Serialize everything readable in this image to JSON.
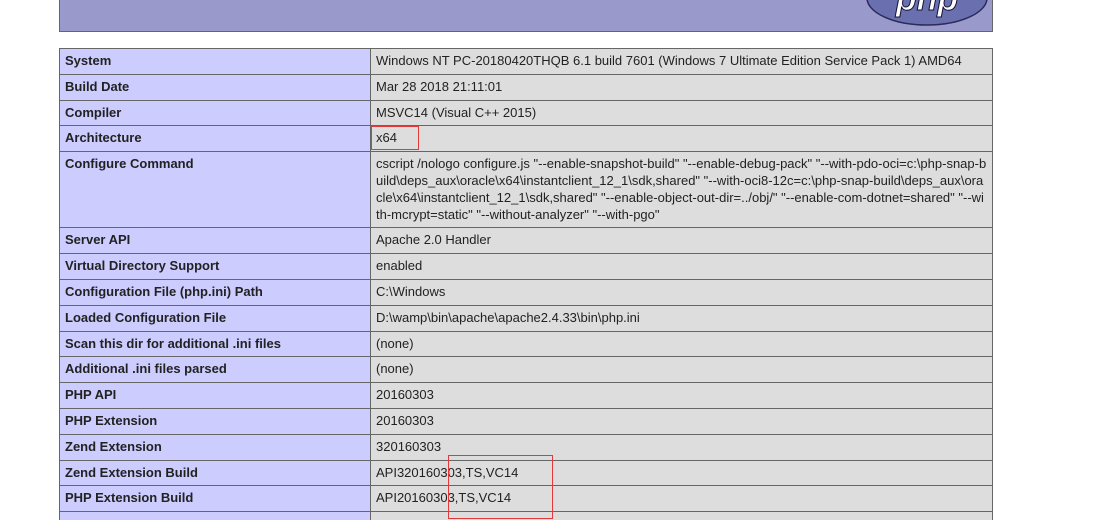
{
  "header": {
    "logo_text": "php"
  },
  "rows": [
    {
      "key": "System",
      "value": "Windows NT PC-20180420THQB 6.1 build 7601 (Windows 7 Ultimate Edition Service Pack 1) AMD64"
    },
    {
      "key": "Build Date",
      "value": "Mar 28 2018 21:11:01"
    },
    {
      "key": "Compiler",
      "value": "MSVC14 (Visual C++ 2015)"
    },
    {
      "key": "Architecture",
      "value": "x64"
    },
    {
      "key": "Configure Command",
      "value": "cscript /nologo configure.js \"--enable-snapshot-build\" \"--enable-debug-pack\" \"--with-pdo-oci=c:\\php-snap-build\\deps_aux\\oracle\\x64\\instantclient_12_1\\sdk,shared\" \"--with-oci8-12c=c:\\php-snap-build\\deps_aux\\oracle\\x64\\instantclient_12_1\\sdk,shared\" \"--enable-object-out-dir=../obj/\" \"--enable-com-dotnet=shared\" \"--with-mcrypt=static\" \"--without-analyzer\" \"--with-pgo\""
    },
    {
      "key": "Server API",
      "value": "Apache 2.0 Handler"
    },
    {
      "key": "Virtual Directory Support",
      "value": "enabled"
    },
    {
      "key": "Configuration File (php.ini) Path",
      "value": "C:\\Windows"
    },
    {
      "key": "Loaded Configuration File",
      "value": "D:\\wamp\\bin\\apache\\apache2.4.33\\bin\\php.ini"
    },
    {
      "key": "Scan this dir for additional .ini files",
      "value": "(none)"
    },
    {
      "key": "Additional .ini files parsed",
      "value": "(none)"
    },
    {
      "key": "PHP API",
      "value": "20160303"
    },
    {
      "key": "PHP Extension",
      "value": "20160303"
    },
    {
      "key": "Zend Extension",
      "value": "320160303"
    },
    {
      "key": "Zend Extension Build",
      "value": "API320160303,TS,VC14"
    },
    {
      "key": "PHP Extension Build",
      "value": "API20160303,TS,VC14"
    },
    {
      "key": "",
      "value": ""
    }
  ],
  "colors": {
    "header_bg": "#9999cc",
    "key_cell_bg": "#ccccff",
    "value_cell_bg": "#dddddd",
    "border": "#666666",
    "annotation": "#e23a3a"
  }
}
